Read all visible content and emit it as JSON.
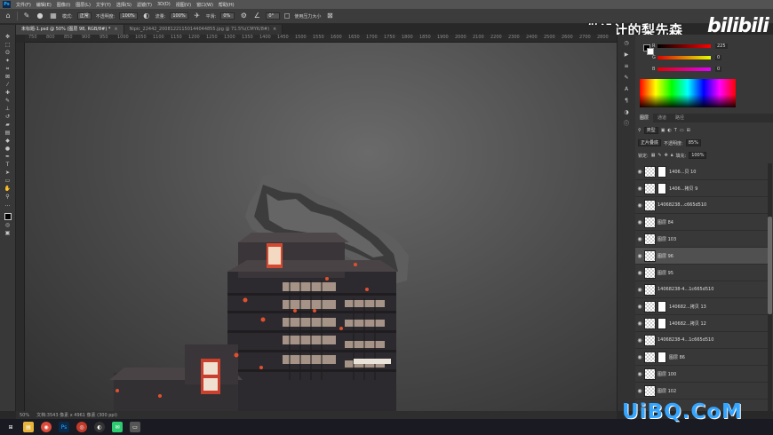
{
  "menubar": {
    "items": [
      "文件(F)",
      "编辑(E)",
      "图像(I)",
      "图层(L)",
      "文字(Y)",
      "选择(S)",
      "滤镜(T)",
      "3D(D)",
      "视图(V)",
      "窗口(W)",
      "帮助(H)"
    ]
  },
  "options": {
    "mode_label": "模式:",
    "mode_value": "正常",
    "opacity_label": "不透明度:",
    "opacity_value": "100%",
    "flow_label": "流量:",
    "flow_value": "100%",
    "smooth_label": "平滑:",
    "smooth_value": "0%",
    "angle_value": "0°",
    "pressure_label": "使用压力大小"
  },
  "watermark": {
    "chinese": "做设计的梨先森",
    "brand": "bilibili",
    "site": "UiBQ.CoM"
  },
  "tabs": [
    {
      "label": "未标题-1.psd @ 50% (图层 98, RGB/8#) *"
    },
    {
      "label": "Nipic_22442_20081221150144044855.jpg @ 71.5%(CMYK/8#)"
    }
  ],
  "ruler": [
    "750",
    "800",
    "850",
    "900",
    "950",
    "1000",
    "1050",
    "1100",
    "1150",
    "1200",
    "1250",
    "1300",
    "1350",
    "1400",
    "1450",
    "1500",
    "1550",
    "1600",
    "1650",
    "1700",
    "1750",
    "1800",
    "1850",
    "1900",
    "2000",
    "2100",
    "2200",
    "2300",
    "2400",
    "2500",
    "2600",
    "2700",
    "2800"
  ],
  "status": {
    "zoom": "50%",
    "doc": "文档:3543 像素 x 4961 像素 (300 ppi)"
  },
  "color_panel": {
    "r_label": "R",
    "r_value": "225",
    "g_label": "G",
    "g_value": "0",
    "b_label": "B",
    "b_value": "0"
  },
  "layers_panel": {
    "tabs": [
      "图层",
      "通道",
      "路径"
    ],
    "kind_label": "类型",
    "blend_mode": "正片叠底",
    "opacity_label": "不透明度:",
    "opacity_value": "85%",
    "lock_label": "锁定:",
    "fill_label": "填充:",
    "fill_value": "100%"
  },
  "layers": [
    {
      "name": "1406...贝 10",
      "mask": true,
      "selected": false
    },
    {
      "name": "1406...拷贝 9",
      "mask": true,
      "selected": false
    },
    {
      "name": "14068238...c665d510",
      "mask": false,
      "selected": false
    },
    {
      "name": "图层 84",
      "mask": false,
      "selected": false
    },
    {
      "name": "图层 103",
      "mask": false,
      "selected": false
    },
    {
      "name": "图层 96",
      "mask": false,
      "selected": true
    },
    {
      "name": "图层 95",
      "mask": false,
      "selected": false
    },
    {
      "name": "14068238-4...1c665d510",
      "mask": false,
      "selected": false
    },
    {
      "name": "140682...拷贝 13",
      "mask": true,
      "selected": false
    },
    {
      "name": "140682...拷贝 12",
      "mask": true,
      "selected": false
    },
    {
      "name": "14068238-4...1c665d510",
      "mask": false,
      "selected": false
    },
    {
      "name": "图层 86",
      "mask": true,
      "selected": false
    },
    {
      "name": "图层 100",
      "mask": false,
      "selected": false
    },
    {
      "name": "图层 102",
      "mask": false,
      "selected": false
    }
  ]
}
